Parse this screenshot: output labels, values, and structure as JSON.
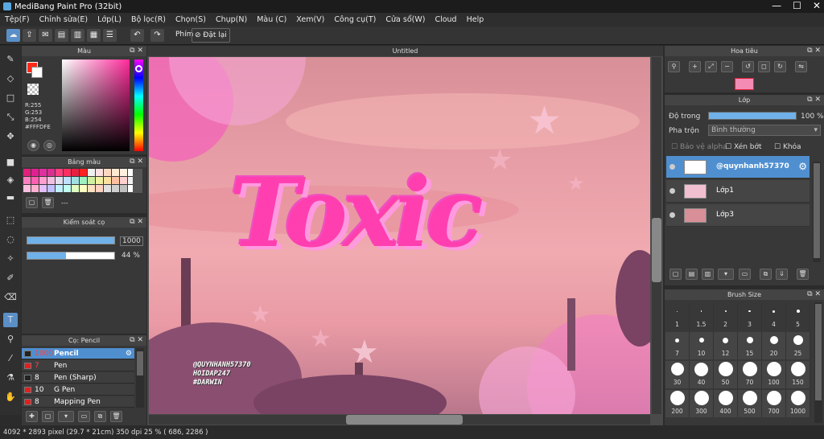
{
  "app": {
    "title": "MediBang Paint Pro (32bit)",
    "win_min": "—",
    "win_max": "☐",
    "win_close": "✕"
  },
  "menu": [
    "Tệp(F)",
    "Chỉnh sửa(E)",
    "Lớp(L)",
    "Bộ lọc(R)",
    "Chọn(S)",
    "Chụp(N)",
    "Màu (C)",
    "Xem(V)",
    "Công cụ(T)",
    "Cửa sổ(W)",
    "Cloud",
    "Help"
  ],
  "toolbar": {
    "shortcut_label": "Phím",
    "reset_label": "Đặt lại"
  },
  "color_panel": {
    "title": "Màu",
    "r": "R:255",
    "g": "G:253",
    "b": "B:254",
    "hex": "#FFFDFE"
  },
  "palette_panel": {
    "title": "Bảng màu",
    "extra": "---"
  },
  "control_panel": {
    "title": "Kiểm soát cọ",
    "size_value": "1000",
    "opacity_value": "44 %",
    "size_fraction": 1.0,
    "opacity_fraction": 0.44
  },
  "brush_panel": {
    "title": "Cọ: Pencil",
    "brushes": [
      {
        "size": "1000",
        "name": "Pencil",
        "selected": true
      },
      {
        "size": "7",
        "name": "Pen",
        "selected": false
      },
      {
        "size": "8",
        "name": "Pen (Sharp)",
        "selected": false
      },
      {
        "size": "10",
        "name": "G Pen",
        "selected": false
      },
      {
        "size": "8",
        "name": "Mapping Pen",
        "selected": false
      }
    ]
  },
  "canvas": {
    "tab_title": "Untitled",
    "art_text": "Toxic",
    "watermark": [
      "@QUYNHANH57370",
      "HOIDAP247",
      "#DARWIN"
    ]
  },
  "navigator": {
    "title": "Hoa tiêu"
  },
  "layer_panel": {
    "title": "Lớp",
    "opacity_label": "Độ trong",
    "opacity_value": "100 %",
    "opacity_fraction": 1.0,
    "blend_label": "Pha trộn",
    "blend_value": "Bình thường",
    "protect_alpha": "Bảo vệ alpha",
    "clip": "Xén bớt",
    "lock": "Khóa",
    "layers": [
      {
        "name": "@quynhanh57370",
        "selected": true
      },
      {
        "name": "Lớp1",
        "selected": false
      },
      {
        "name": "Lớp3",
        "selected": false
      }
    ]
  },
  "brush_size_panel": {
    "title": "Brush Size",
    "sizes": [
      "1",
      "1.5",
      "2",
      "3",
      "4",
      "5",
      "7",
      "10",
      "12",
      "15",
      "20",
      "25",
      "30",
      "40",
      "50",
      "70",
      "100",
      "150",
      "200",
      "300",
      "400",
      "500",
      "700",
      "1000"
    ]
  },
  "status": {
    "text": "4092 * 2893 pixel  (29.7 * 21cm)  350 dpi  25 %  ( 686, 2286 )"
  },
  "colors": {
    "accent": "#4f8fd0",
    "toxic_pink": "#ff3fb0",
    "fg_color": "#ff2a1a"
  }
}
